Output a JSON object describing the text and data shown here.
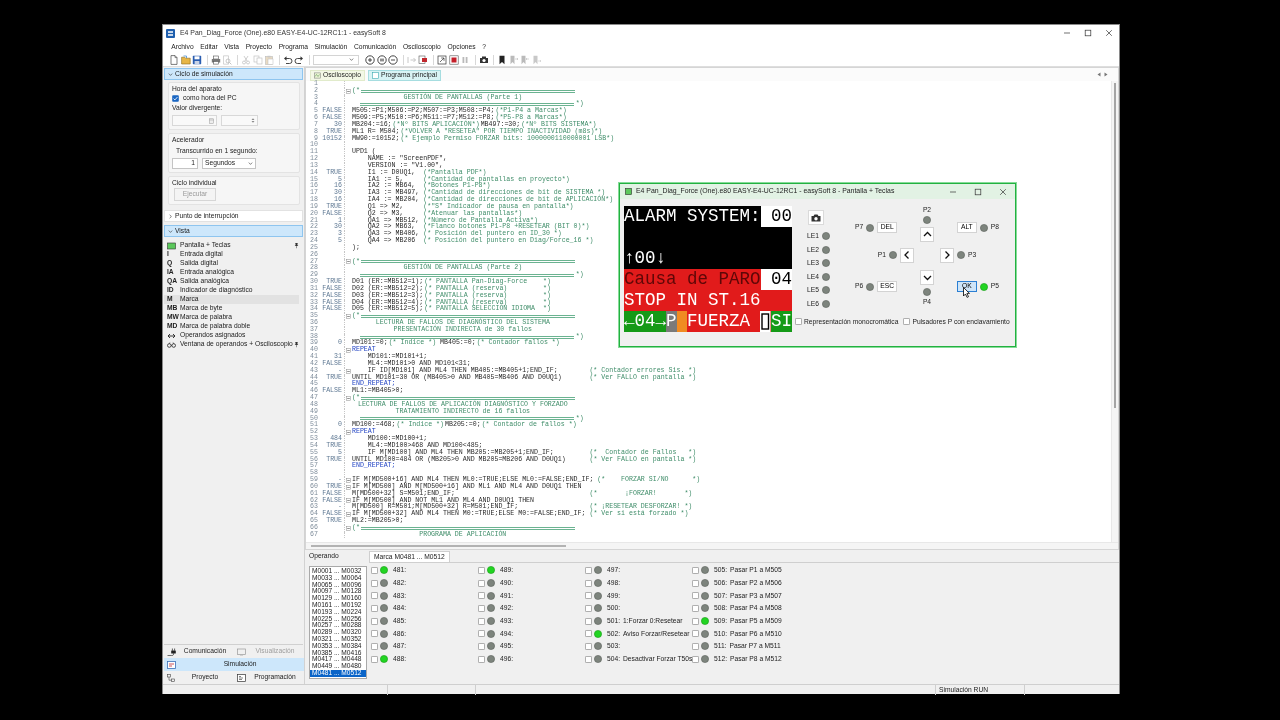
{
  "window": {
    "title": "E4 Pan_Diag_Force (One).e80 EASY-E4-UC-12RC1:1 - easySoft 8"
  },
  "menu": [
    "Archivo",
    "Editar",
    "Vista",
    "Proyecto",
    "Programa",
    "Simulación",
    "Comunicación",
    "Osciloscopio",
    "Opciones",
    "?"
  ],
  "toolbar": [
    {
      "disabled": false
    },
    {
      "disabled": false
    },
    {
      "disabled": false
    },
    {
      "disabled": false
    },
    {
      "disabled": true
    },
    {
      "disabled": true
    },
    {
      "disabled": true
    },
    {
      "disabled": true
    },
    {
      "disabled": false
    },
    {
      "disabled": false
    },
    {
      "disabled": false
    },
    {
      "disabled": false
    },
    {
      "disabled": false
    },
    {
      "disabled": true
    },
    {
      "disabled": false
    },
    {
      "disabled": false
    },
    {
      "disabled": false
    },
    {
      "disabled": true
    },
    {
      "disabled": false
    },
    {
      "disabled": false
    },
    {
      "disabled": true
    },
    {
      "disabled": true
    },
    {
      "disabled": true
    }
  ],
  "sidebar": {
    "simulation": {
      "title": "Ciclo de simulación",
      "expanded": true,
      "device_time": {
        "title": "Hora del aparato",
        "use_pc": {
          "label": "como hora del PC",
          "checked": true
        },
        "divergent": {
          "label": "Valor divergente:",
          "disabled": true
        }
      },
      "accelerator": {
        "title": "Acelerador",
        "label": "Transcurrido en 1 segundo:",
        "value": "1",
        "unit": "Segundos"
      },
      "single_cycle": {
        "title": "Ciclo individual",
        "button": {
          "label": "Ejecutar",
          "disabled": true
        }
      }
    },
    "breakpoint": {
      "title": "Punto de interrupción",
      "expanded": false
    },
    "view": {
      "title": "Vista",
      "expanded": true,
      "items": [
        {
          "kind": "icon",
          "label": "Pantalla + Teclas",
          "selected": false,
          "pinned": true
        },
        {
          "kind": "glyph",
          "glyph": "I",
          "label": "Entrada digital",
          "selected": false,
          "pinned": false
        },
        {
          "kind": "glyph",
          "glyph": "Q",
          "label": "Salida digital",
          "selected": false,
          "pinned": false
        },
        {
          "kind": "glyph",
          "glyph": "IA",
          "label": "Entrada analógica",
          "selected": false,
          "pinned": false
        },
        {
          "kind": "glyph",
          "glyph": "QA",
          "label": "Salida analógica",
          "selected": false,
          "pinned": false
        },
        {
          "kind": "glyph",
          "glyph": "ID",
          "label": "Indicador de diagnóstico",
          "selected": false,
          "pinned": false
        },
        {
          "kind": "glyph",
          "glyph": "M",
          "label": "Marca",
          "selected": true,
          "pinned": false
        },
        {
          "kind": "glyph",
          "glyph": "MB",
          "label": "Marca de byte",
          "selected": false,
          "pinned": false
        },
        {
          "kind": "glyph",
          "glyph": "MW",
          "label": "Marca de palabra",
          "selected": false,
          "pinned": false
        },
        {
          "kind": "glyph",
          "glyph": "MD",
          "label": "Marca de palabra doble",
          "selected": false,
          "pinned": false
        },
        {
          "kind": "icon",
          "label": "Operandos asignados",
          "selected": false,
          "pinned": false
        },
        {
          "kind": "icon",
          "label": "Ventana de operandos + Osciloscopio",
          "selected": false,
          "pinned": true
        }
      ]
    },
    "nav": [
      {
        "label": "Comunicación",
        "selected": false,
        "disabled": false
      },
      {
        "label": "Visualización",
        "selected": false,
        "disabled": true
      },
      {
        "label": "Simulación",
        "selected": true,
        "disabled": false
      },
      {
        "label": "Proyecto",
        "selected": false,
        "disabled": false
      },
      {
        "label": "Programación",
        "selected": false,
        "disabled": false
      }
    ]
  },
  "editor": {
    "tabs": [
      {
        "label": "Osciloscopio",
        "selected": false
      },
      {
        "label": "Programa principal",
        "selected": true
      }
    ],
    "lines": [
      {
        "n": "1"
      },
      {
        "n": "2",
        "fold": true,
        "parts": [
          {
            "kind": "open",
            "text": "(*"
          }
        ]
      },
      {
        "n": "3",
        "parts": [
          {
            "kind": "banner",
            "text": "GESTIÓN DE PANTALLAS (Parte 1)"
          }
        ]
      },
      {
        "n": "4",
        "parts": [
          {
            "kind": "close",
            "text": "*)"
          }
        ]
      },
      {
        "n": "5",
        "value": "FALSE",
        "parts": [
          {
            "kind": "code",
            "text": "M505:=P1;M506:=P2;M507:=P3;M508:=P4;"
          },
          {
            "kind": "comment",
            "text": "(*P1-P4 a Marcas*)"
          }
        ]
      },
      {
        "n": "6",
        "value": "FALSE",
        "parts": [
          {
            "kind": "code",
            "text": "M509:=P5;M510:=P6;M511:=P7;M512:=P8;"
          },
          {
            "kind": "comment",
            "text": "(*P5-P8 a Marcas*)"
          }
        ]
      },
      {
        "n": "7",
        "value": "30",
        "parts": [
          {
            "kind": "code",
            "text": "MB204:=16;"
          },
          {
            "kind": "comment",
            "text": "(*Nº BITS APLICACIÓN*)"
          },
          {
            "kind": "code",
            "text": "MB497:=30;"
          },
          {
            "kind": "comment",
            "text": "(*Nº BITS SISTEMA*)"
          }
        ]
      },
      {
        "n": "8",
        "value": "TRUE",
        "parts": [
          {
            "kind": "code",
            "text": "ML1 R= M504;"
          },
          {
            "kind": "comment",
            "text": "(*VOLVER A \"RESETEA\" POR TIEMPO INACTIVIDAD (m8s)*)"
          }
        ]
      },
      {
        "n": "9",
        "value": "10152",
        "parts": [
          {
            "kind": "code",
            "text": "MW90:=10152;"
          },
          {
            "kind": "comment",
            "text": "(* Ejemplo Permiso FORZAR bits: 1000000110000001 LSB*)"
          }
        ]
      },
      {
        "n": "10"
      },
      {
        "n": "11",
        "parts": [
          {
            "kind": "code",
            "text": "UPD1 ("
          }
        ]
      },
      {
        "n": "12",
        "parts": [
          {
            "kind": "code",
            "text": "    NAME := \"ScreenPDF\","
          }
        ]
      },
      {
        "n": "13",
        "parts": [
          {
            "kind": "code",
            "text": "    VERSION := \"V1.00\","
          }
        ]
      },
      {
        "n": "14",
        "value": "TRUE",
        "parts": [
          {
            "kind": "code",
            "text": "    I1 := D0UQ1,"
          },
          {
            "kind": "aside",
            "text": "(*Pantalla PDF*)"
          }
        ]
      },
      {
        "n": "15",
        "value": "5",
        "parts": [
          {
            "kind": "code",
            "text": "    IA1 := 5,"
          },
          {
            "kind": "aside",
            "text": "(*Cantidad de pantallas en proyecto*)"
          }
        ]
      },
      {
        "n": "16",
        "value": "16",
        "parts": [
          {
            "kind": "code",
            "text": "    IA2 := MB64,"
          },
          {
            "kind": "aside",
            "text": "(*Botones P1-P8*)"
          }
        ]
      },
      {
        "n": "17",
        "value": "30",
        "parts": [
          {
            "kind": "code",
            "text": "    IA3 := MB497,"
          },
          {
            "kind": "aside",
            "text": "(*Cantidad de direcciones de bit de SISTEMA *)"
          }
        ]
      },
      {
        "n": "18",
        "value": "16",
        "parts": [
          {
            "kind": "code",
            "text": "    IA4 := MB204,"
          },
          {
            "kind": "aside",
            "text": "(*Cantidad de direcciones de bit de APLICACIÓN*)"
          }
        ]
      },
      {
        "n": "19",
        "value": "TRUE",
        "parts": [
          {
            "kind": "code",
            "text": "    Q1 => M2,"
          },
          {
            "kind": "aside",
            "text": "(*\"S\" Indicador de pausa en pantalla*)"
          }
        ]
      },
      {
        "n": "20",
        "value": "FALSE",
        "parts": [
          {
            "kind": "code",
            "text": "    Q2 => M3,"
          },
          {
            "kind": "aside",
            "text": "(*Atenuar las pantallas*)"
          }
        ]
      },
      {
        "n": "21",
        "value": "1",
        "parts": [
          {
            "kind": "code",
            "text": "    QA1 => MB512,"
          },
          {
            "kind": "aside",
            "text": "(*Número de Pantalla Activa*)"
          }
        ]
      },
      {
        "n": "22",
        "value": "30",
        "parts": [
          {
            "kind": "code",
            "text": "    QA2 => MB63,"
          },
          {
            "kind": "aside",
            "text": "(*Flanco botones P1-P8 +RESETEAR (BIT 0)*)"
          }
        ]
      },
      {
        "n": "23",
        "value": "3",
        "parts": [
          {
            "kind": "code",
            "text": "    QA3 => MB406,"
          },
          {
            "kind": "aside",
            "text": "(* Posición del puntero en ID_30 *)"
          }
        ]
      },
      {
        "n": "24",
        "value": "5",
        "parts": [
          {
            "kind": "code",
            "text": "    QA4 => MB206"
          },
          {
            "kind": "aside",
            "text": "(* Posición del puntero en Diag/Force_16 *)"
          }
        ]
      },
      {
        "n": "25",
        "parts": [
          {
            "kind": "code",
            "text": ");"
          }
        ]
      },
      {
        "n": "26"
      },
      {
        "n": "27",
        "fold": true,
        "parts": [
          {
            "kind": "open",
            "text": "(*"
          }
        ]
      },
      {
        "n": "28",
        "parts": [
          {
            "kind": "banner",
            "text": "GESTIÓN DE PANTALLAS (Parte 2)"
          }
        ]
      },
      {
        "n": "29",
        "parts": [
          {
            "kind": "close",
            "text": "*)"
          }
        ]
      },
      {
        "n": "30",
        "value": "TRUE",
        "parts": [
          {
            "kind": "code",
            "text": "D01 (ER:=MB512=1);"
          },
          {
            "kind": "comment",
            "text": "(* PANTALLA Pan-Diag-Force    *)"
          }
        ]
      },
      {
        "n": "31",
        "value": "FALSE",
        "parts": [
          {
            "kind": "code",
            "text": "D02 (ER:=MB512=2);"
          },
          {
            "kind": "comment",
            "text": "(* PANTALLA (reserva)         *)"
          }
        ]
      },
      {
        "n": "32",
        "value": "FALSE",
        "parts": [
          {
            "kind": "code",
            "text": "D03 (ER:=MB512=3);"
          },
          {
            "kind": "comment",
            "text": "(* PANTALLA (reserva)         *)"
          }
        ]
      },
      {
        "n": "33",
        "value": "FALSE",
        "parts": [
          {
            "kind": "code",
            "text": "D04 (ER:=MB512=4);"
          },
          {
            "kind": "comment",
            "text": "(* PANTALLA (reserva)         *)"
          }
        ]
      },
      {
        "n": "34",
        "value": "FALSE",
        "parts": [
          {
            "kind": "code",
            "text": "D05 (ER:=MB512=5);"
          },
          {
            "kind": "comment",
            "text": "(* PANTALLA SELECCIÓN IDIOMA  *)"
          }
        ]
      },
      {
        "n": "35",
        "fold": true,
        "parts": [
          {
            "kind": "open",
            "text": "(*"
          }
        ]
      },
      {
        "n": "36",
        "parts": [
          {
            "kind": "banner",
            "text": "LECTURA DE FALLOS DE DIAGNÓSTICO DEL SISTEMA"
          }
        ]
      },
      {
        "n": "37",
        "parts": [
          {
            "kind": "banner",
            "text": "PRESENTACIÓN INDIRECTA de 30 fallos"
          }
        ]
      },
      {
        "n": "38",
        "parts": [
          {
            "kind": "close",
            "text": "*)"
          }
        ]
      },
      {
        "n": "39",
        "value": "0",
        "parts": [
          {
            "kind": "code",
            "text": "MD101:=0;"
          },
          {
            "kind": "comment",
            "text": "(* Indice *)"
          },
          {
            "kind": "code",
            "text": " MB405:=0;"
          },
          {
            "kind": "comment",
            "text": "(* Contador fallos *)"
          }
        ]
      },
      {
        "n": "40",
        "fold": true,
        "parts": [
          {
            "kind": "keyword",
            "text": "REPEAT"
          }
        ]
      },
      {
        "n": "41",
        "value": "31",
        "parts": [
          {
            "kind": "code",
            "text": "    MD101:=MD101+1;"
          }
        ]
      },
      {
        "n": "42",
        "value": "FALSE",
        "parts": [
          {
            "kind": "code",
            "text": "    ML4:=MD101>0 AND MD101<31;"
          }
        ]
      },
      {
        "n": "43",
        "value": "-",
        "fold": true,
        "parts": [
          {
            "kind": "code",
            "text": "    IF ID[MD101] AND ML4 THEN MB405:=MB405+1;END_IF;"
          },
          {
            "kind": "margin",
            "text": "(* Contador errores Sis. *)"
          }
        ]
      },
      {
        "n": "44",
        "value": "TRUE",
        "parts": [
          {
            "kind": "code",
            "text": "UNTIL MD101=30 OR (MB405>0 AND MB405=MB406 AND D0UQ1)"
          },
          {
            "kind": "margin",
            "text": "(* Ver FALLO en pantalla *)"
          }
        ]
      },
      {
        "n": "45",
        "parts": [
          {
            "kind": "keyword",
            "text": "END_REPEAT;"
          }
        ]
      },
      {
        "n": "46",
        "value": "FALSE",
        "parts": [
          {
            "kind": "code",
            "text": "ML1:=MB405>0;"
          }
        ]
      },
      {
        "n": "47",
        "fold": true,
        "parts": [
          {
            "kind": "open",
            "text": "(*"
          }
        ]
      },
      {
        "n": "48",
        "parts": [
          {
            "kind": "banner",
            "text": "LECTURA DE FALLOS DE APLICACIÓN DIAGNÓSTICO Y FORZADO"
          }
        ]
      },
      {
        "n": "49",
        "parts": [
          {
            "kind": "banner",
            "text": "TRATAMIENTO INDIRECTO de 16 fallos"
          }
        ]
      },
      {
        "n": "50",
        "parts": [
          {
            "kind": "close",
            "text": "*)"
          }
        ]
      },
      {
        "n": "51",
        "value": "0",
        "parts": [
          {
            "kind": "code",
            "text": "MD100:=468;"
          },
          {
            "kind": "comment",
            "text": "(* Indice *)"
          },
          {
            "kind": "code",
            "text": "MB205:=0;"
          },
          {
            "kind": "comment",
            "text": "(* Contador de fallos *)"
          }
        ]
      },
      {
        "n": "52",
        "fold": true,
        "parts": [
          {
            "kind": "keyword",
            "text": "REPEAT"
          }
        ]
      },
      {
        "n": "53",
        "value": "484",
        "parts": [
          {
            "kind": "code",
            "text": "    MD100:=MD100+1;"
          }
        ]
      },
      {
        "n": "54",
        "value": "TRUE",
        "parts": [
          {
            "kind": "code",
            "text": "    ML4:=MD100>468 AND MD100<485;"
          }
        ]
      },
      {
        "n": "55",
        "value": "5",
        "parts": [
          {
            "kind": "code",
            "text": "    IF M[MD100] AND ML4 THEN MB205:=MB205+1;END_IF;"
          },
          {
            "kind": "margin",
            "text": "(*  Contador de Fallos   *)"
          }
        ]
      },
      {
        "n": "56",
        "value": "TRUE",
        "parts": [
          {
            "kind": "code",
            "text": "UNTIL MD100=484 OR (MB205>0 AND MB205=MB206 AND D0UQ1)"
          },
          {
            "kind": "margin",
            "text": "(* Ver FALLO en pantalla *)"
          }
        ]
      },
      {
        "n": "57",
        "parts": [
          {
            "kind": "keyword",
            "text": "END_REPEAT;"
          }
        ]
      },
      {
        "n": "58"
      },
      {
        "n": "59",
        "value": "-",
        "fold": true,
        "parts": [
          {
            "kind": "code",
            "text": "IF M[MD500+16] AND ML4 THEN ML0:=TRUE;ELSE ML0:=FALSE;END_IF;"
          },
          {
            "kind": "margin",
            "text": "(*    FORZAR SI/NO      *)"
          }
        ]
      },
      {
        "n": "60",
        "value": "TRUE",
        "fold": true,
        "parts": [
          {
            "kind": "code",
            "text": "IF M[MD500] AND M[MD500+16] AND ML1 AND ML4 AND D0UQ1 THEN"
          }
        ]
      },
      {
        "n": "61",
        "value": "FALSE",
        "parts": [
          {
            "kind": "code",
            "text": "M[MD500+32] S=M501;END_IF;"
          },
          {
            "kind": "margin",
            "text": "(*       ¡FORZAR!       *)"
          }
        ]
      },
      {
        "n": "62",
        "value": "FALSE",
        "fold": true,
        "parts": [
          {
            "kind": "code",
            "text": "IF M[MD500] AND NOT ML1 AND ML4 AND D0UQ1 THEN"
          }
        ]
      },
      {
        "n": "63",
        "value": "-",
        "parts": [
          {
            "kind": "code",
            "text": "M[MD500] R=M501;M[MD500+32] R=M501;END_IF;"
          },
          {
            "kind": "margin",
            "text": "(* ¡RESETEAR DESFORZAR! *)"
          }
        ]
      },
      {
        "n": "64",
        "value": "FALSE",
        "fold": true,
        "parts": [
          {
            "kind": "code",
            "text": "IF M[MD500+32] AND ML4 THEN M0:=TRUE;ELSE M0:=FALSE;END_IF;"
          },
          {
            "kind": "margin",
            "text": "(* Ver si está forzado *)"
          }
        ]
      },
      {
        "n": "65",
        "value": "TRUE",
        "parts": [
          {
            "kind": "code",
            "text": "ML2:=MB205>0;"
          }
        ]
      },
      {
        "n": "66",
        "fold": true,
        "parts": [
          {
            "kind": "open",
            "text": "(*"
          }
        ]
      },
      {
        "n": "67",
        "parts": [
          {
            "kind": "banner",
            "text": "PROGRAMA DE APLICACIÓN"
          }
        ]
      }
    ]
  },
  "operands": {
    "title": "Operando",
    "tab": "Marca M0481 ... M0512",
    "ranges": [
      {
        "label": "M0001 ... M0032",
        "selected": false
      },
      {
        "label": "M0033 ... M0064",
        "selected": false
      },
      {
        "label": "M0065 ... M0096",
        "selected": false
      },
      {
        "label": "M0097 ... M0128",
        "selected": false
      },
      {
        "label": "M0129 ... M0160",
        "selected": false
      },
      {
        "label": "M0161 ... M0192",
        "selected": false
      },
      {
        "label": "M0193 ... M0224",
        "selected": false
      },
      {
        "label": "M0225 ... M0256",
        "selected": false
      },
      {
        "label": "M0257 ... M0288",
        "selected": false
      },
      {
        "label": "M0289 ... M0320",
        "selected": false
      },
      {
        "label": "M0321 ... M0352",
        "selected": false
      },
      {
        "label": "M0353 ... M0384",
        "selected": false
      },
      {
        "label": "M0385 ... M0416",
        "selected": false
      },
      {
        "label": "M0417 ... M0448",
        "selected": false
      },
      {
        "label": "M0449 ... M0480",
        "selected": false
      },
      {
        "label": "M0481 ... M0512",
        "selected": true
      }
    ],
    "markers": [
      {
        "number": "481:",
        "checked": false,
        "lit": true
      },
      {
        "number": "482:",
        "checked": false,
        "lit": false
      },
      {
        "number": "483:",
        "checked": false,
        "lit": false
      },
      {
        "number": "484:",
        "checked": false,
        "lit": false
      },
      {
        "number": "485:",
        "checked": false,
        "lit": false
      },
      {
        "number": "486:",
        "checked": false,
        "lit": false
      },
      {
        "number": "487:",
        "checked": false,
        "lit": false
      },
      {
        "number": "488:",
        "checked": false,
        "lit": true
      },
      {
        "number": "489:",
        "checked": false,
        "lit": true
      },
      {
        "number": "490:",
        "checked": false,
        "lit": false
      },
      {
        "number": "491:",
        "checked": false,
        "lit": false
      },
      {
        "number": "492:",
        "checked": false,
        "lit": false
      },
      {
        "number": "493:",
        "checked": false,
        "lit": false
      },
      {
        "number": "494:",
        "checked": false,
        "lit": false
      },
      {
        "number": "495:",
        "checked": false,
        "lit": false
      },
      {
        "number": "496:",
        "checked": false,
        "lit": false
      },
      {
        "number": "497:",
        "checked": false,
        "lit": false
      },
      {
        "number": "498:",
        "checked": false,
        "lit": false
      },
      {
        "number": "499:",
        "checked": false,
        "lit": false
      },
      {
        "number": "500:",
        "checked": false,
        "lit": false
      },
      {
        "number": "501:",
        "label": "1:Forzar 0:Resetear",
        "checked": false,
        "lit": false
      },
      {
        "number": "502:",
        "label": "Aviso Forzar/Resetear",
        "checked": false,
        "lit": true
      },
      {
        "number": "503:",
        "checked": false,
        "lit": false
      },
      {
        "number": "504:",
        "label": "Desactivar Forzar T50s",
        "checked": false,
        "lit": false
      },
      {
        "number": "505:",
        "label": "Pasar P1 a M505",
        "checked": false,
        "lit": false
      },
      {
        "number": "506:",
        "label": "Pasar P2 a M506",
        "checked": false,
        "lit": false
      },
      {
        "number": "507:",
        "label": "Pasar P3 a M507",
        "checked": false,
        "lit": false
      },
      {
        "number": "508:",
        "label": "Pasar P4 a M508",
        "checked": false,
        "lit": false
      },
      {
        "number": "509:",
        "label": "Pasar P5 a M509",
        "checked": false,
        "lit": true
      },
      {
        "number": "510:",
        "label": "Pasar P6 a M510",
        "checked": false,
        "lit": false
      },
      {
        "number": "511:",
        "label": "Pasar P7 a M511",
        "checked": false,
        "lit": false
      },
      {
        "number": "512:",
        "label": "Pasar P8 a M512",
        "checked": false,
        "lit": false
      }
    ]
  },
  "status_bar": {
    "text": "Simulación RUN"
  },
  "display_window": {
    "title": "E4 Pan_Diag_Force (One).e80 EASY-E4-UC-12RC1 - easySoft 8 - Pantalla + Teclas",
    "lcd": [
      {
        "kind": "dark",
        "segments": [
          {
            "kind": "text",
            "text": "ALARM SYSTEM:"
          },
          {
            "kind": "inverse",
            "text": "00"
          }
        ]
      },
      {
        "kind": "dark"
      },
      {
        "kind": "dark",
        "segments": [
          {
            "kind": "text",
            "text": "↑00↓"
          }
        ]
      },
      {
        "kind": "alarm",
        "segments": [
          {
            "kind": "dim",
            "text": "Causa de PARO"
          },
          {
            "kind": "inverse",
            "text": "04"
          }
        ]
      },
      {
        "kind": "alarm",
        "segments": [
          {
            "kind": "text",
            "text": "STOP IN ST.16"
          }
        ]
      },
      {
        "kind": "alarm",
        "segments": [
          {
            "kind": "green",
            "text": "←04→"
          },
          {
            "kind": "gray",
            "text": "P"
          },
          {
            "kind": "marker"
          },
          {
            "kind": "text",
            "text": "FUERZA"
          },
          {
            "kind": "cursor"
          },
          {
            "kind": "green",
            "text": "SI"
          }
        ]
      }
    ],
    "leds": [
      {
        "label": "LE1",
        "lit": false
      },
      {
        "label": "LE2",
        "lit": false
      },
      {
        "label": "LE3",
        "lit": false
      },
      {
        "label": "LE4",
        "lit": false
      },
      {
        "label": "LE5",
        "lit": false
      },
      {
        "label": "LE6",
        "lit": false
      }
    ],
    "keys": [
      {
        "label": "P7",
        "kind": "text",
        "button": "DEL",
        "lit": false,
        "pressed": false
      },
      {
        "label": "P2",
        "kind": "arrow",
        "lit": false,
        "pressed": false
      },
      {
        "label": "P8",
        "kind": "text",
        "button": "ALT",
        "lit": false,
        "pressed": false
      },
      {
        "label": "P1",
        "kind": "arrow",
        "lit": false,
        "pressed": false
      },
      {
        "label": "P3",
        "kind": "arrow",
        "lit": false,
        "pressed": false
      },
      {
        "label": "P6",
        "kind": "text",
        "button": "ESC",
        "lit": false,
        "pressed": false
      },
      {
        "label": "P4",
        "kind": "arrow",
        "lit": false,
        "pressed": false
      },
      {
        "label": "P5",
        "kind": "text",
        "button": "OK",
        "lit": true,
        "pressed": true
      }
    ],
    "options": [
      {
        "label": "Representación monocromática",
        "checked": false
      },
      {
        "label": "Pulsadores P con enclavamiento",
        "checked": false
      }
    ]
  }
}
